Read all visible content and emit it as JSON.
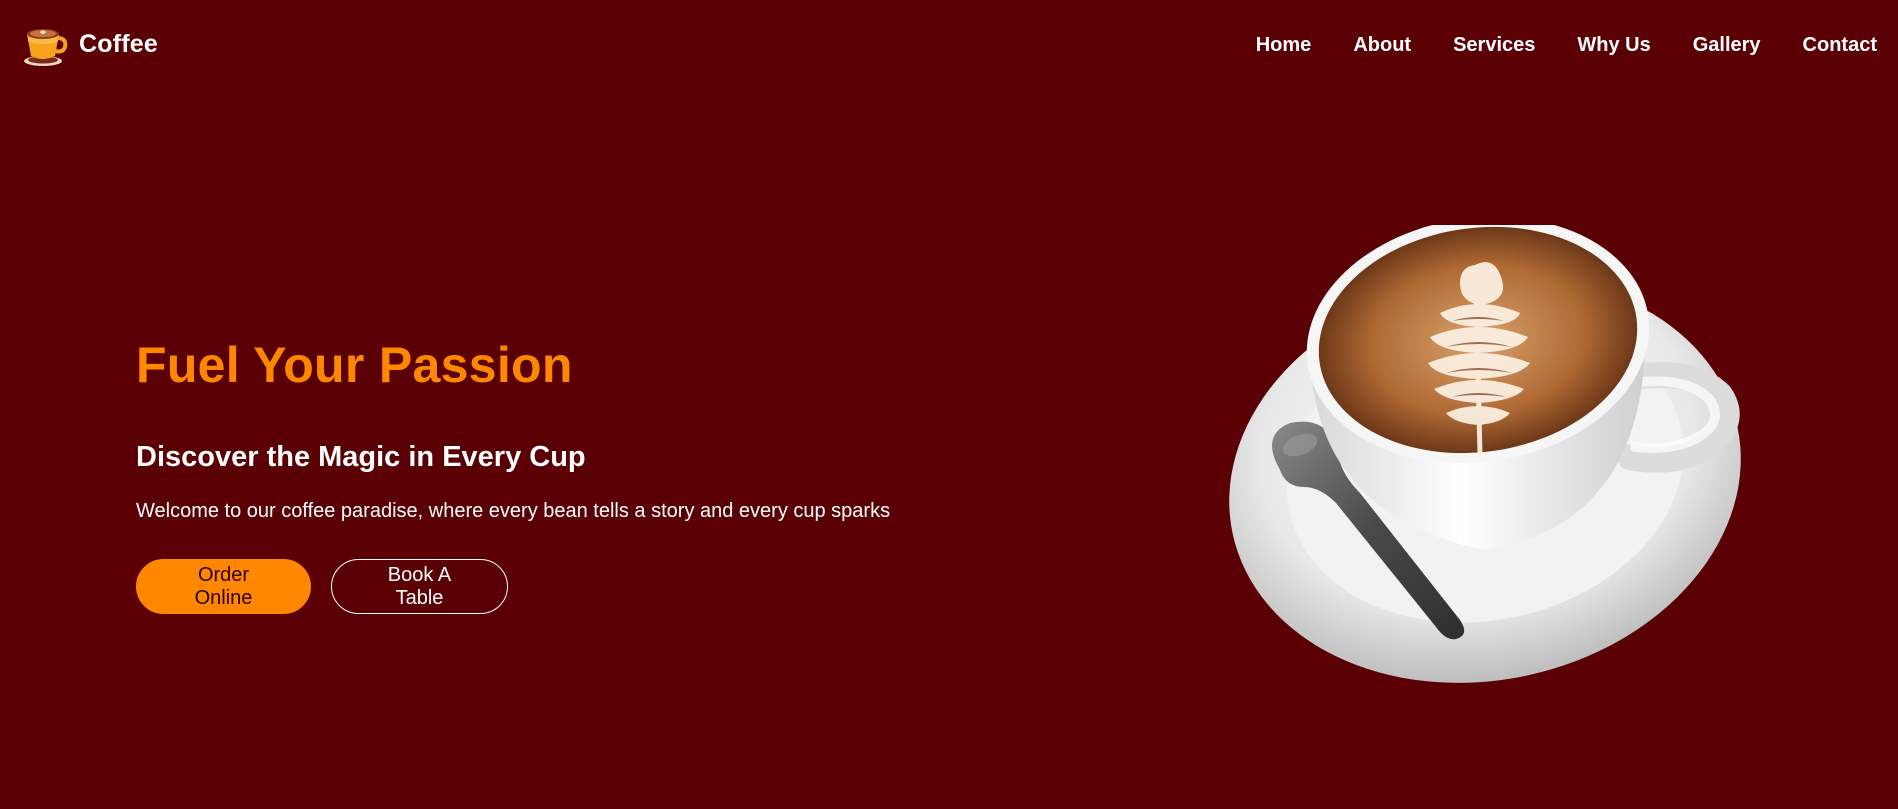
{
  "brand": {
    "name": "Coffee",
    "logo_icon": "coffee-cup-icon"
  },
  "nav": {
    "items": [
      {
        "label": "Home"
      },
      {
        "label": "About"
      },
      {
        "label": "Services"
      },
      {
        "label": "Why Us"
      },
      {
        "label": "Gallery"
      },
      {
        "label": "Contact"
      }
    ]
  },
  "hero": {
    "title": "Fuel Your Passion",
    "subtitle": "Discover the Magic in Every Cup",
    "description": "Welcome to our coffee paradise, where every bean tells a story and every cup sparks",
    "buttons": {
      "order_label": "Order Online",
      "book_label": "Book A Table"
    },
    "image_icon": "latte-cup-illustration"
  },
  "colors": {
    "background": "#5a0005",
    "accent": "#ff8700",
    "text": "#ffffff"
  }
}
